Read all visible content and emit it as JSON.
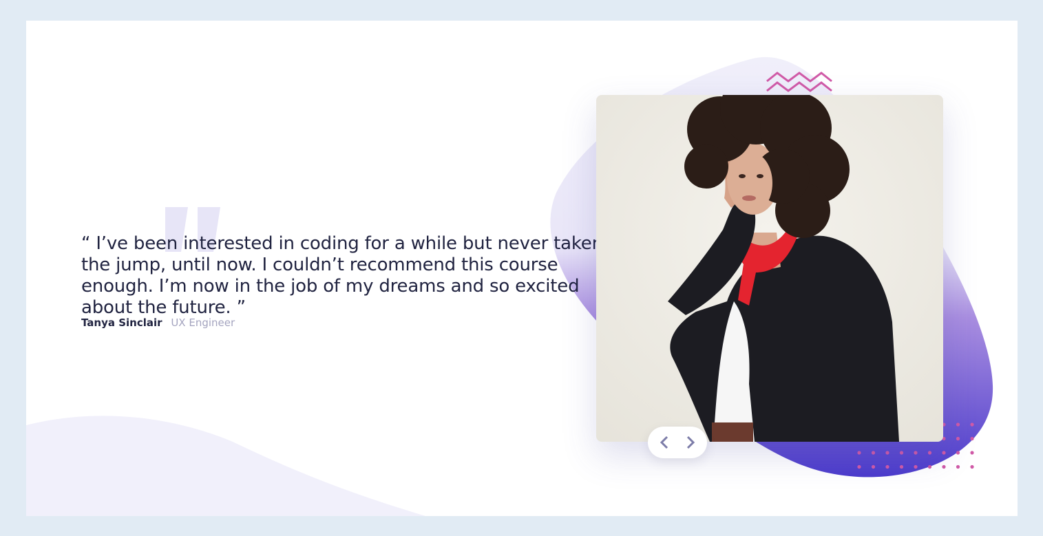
{
  "testimonial": {
    "quote": "“ I’ve been interested in coding for a while but never taken the jump, until now. I couldn’t recommend this course enough. I’m now in the job of my dreams and so excited about the future. ”",
    "author_name": "Tanya Sinclair",
    "author_role": "UX Engineer"
  },
  "icons": {
    "decor_quote": "quote-icon",
    "prev": "chevron-left-icon",
    "next": "chevron-right-icon",
    "zigzag": "zigzag-pattern-icon",
    "dots": "dot-grid-pattern-icon"
  },
  "colors": {
    "page_background": "#e1ebf4",
    "card_background": "#ffffff",
    "text_dark": "#202340",
    "text_muted": "#a4a4bf",
    "wave_light": "#f1f0fb",
    "blob_gradient_start": "#9a6fd8",
    "blob_gradient_end": "#4c3ccc",
    "accent_pink": "#d05aa7",
    "nav_arrow": "#7c7ca8"
  }
}
